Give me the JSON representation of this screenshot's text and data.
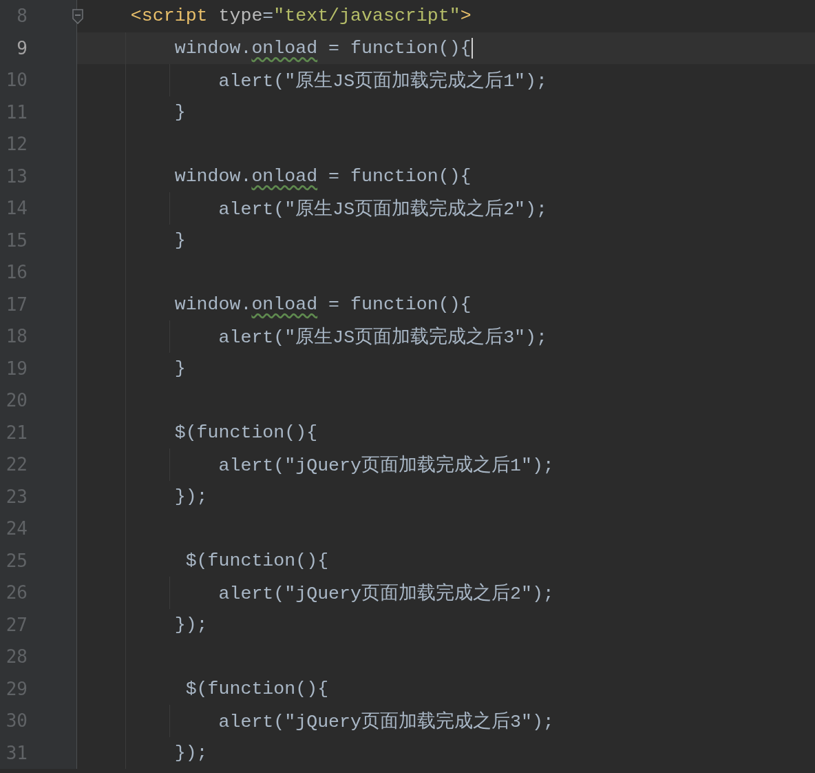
{
  "editor": {
    "lines": [
      {
        "number": "8",
        "selected": false,
        "foldable": true,
        "caret": false,
        "tokens": [
          {
            "kind": "tag",
            "text": "    <script"
          },
          {
            "kind": "attr",
            "text": " type"
          },
          {
            "kind": "plain",
            "text": "="
          },
          {
            "kind": "string",
            "text": "\"text/javascript\""
          },
          {
            "kind": "tag",
            "text": ">"
          }
        ]
      },
      {
        "number": "9",
        "selected": true,
        "foldable": false,
        "caret": true,
        "tokens": [
          {
            "kind": "plain",
            "text": "        window."
          },
          {
            "kind": "warn",
            "text": "onload"
          },
          {
            "kind": "plain",
            "text": " = function(){"
          }
        ]
      },
      {
        "number": "10",
        "selected": false,
        "foldable": false,
        "caret": false,
        "tokens": [
          {
            "kind": "plain",
            "text": "            alert(\"原生JS页面加载完成之后1\");"
          }
        ]
      },
      {
        "number": "11",
        "selected": false,
        "foldable": false,
        "caret": false,
        "tokens": [
          {
            "kind": "plain",
            "text": "        }"
          }
        ]
      },
      {
        "number": "12",
        "selected": false,
        "foldable": false,
        "caret": false
      },
      {
        "number": "13",
        "selected": false,
        "foldable": false,
        "caret": false,
        "tokens": [
          {
            "kind": "plain",
            "text": "        window."
          },
          {
            "kind": "warn",
            "text": "onload"
          },
          {
            "kind": "plain",
            "text": " = function(){"
          }
        ]
      },
      {
        "number": "14",
        "selected": false,
        "foldable": false,
        "caret": false,
        "tokens": [
          {
            "kind": "plain",
            "text": "            alert(\"原生JS页面加载完成之后2\");"
          }
        ]
      },
      {
        "number": "15",
        "selected": false,
        "foldable": false,
        "caret": false,
        "tokens": [
          {
            "kind": "plain",
            "text": "        }"
          }
        ]
      },
      {
        "number": "16",
        "selected": false,
        "foldable": false,
        "caret": false
      },
      {
        "number": "17",
        "selected": false,
        "foldable": false,
        "caret": false,
        "tokens": [
          {
            "kind": "plain",
            "text": "        window."
          },
          {
            "kind": "warn",
            "text": "onload"
          },
          {
            "kind": "plain",
            "text": " = function(){"
          }
        ]
      },
      {
        "number": "18",
        "selected": false,
        "foldable": false,
        "caret": false,
        "tokens": [
          {
            "kind": "plain",
            "text": "            alert(\"原生JS页面加载完成之后3\");"
          }
        ]
      },
      {
        "number": "19",
        "selected": false,
        "foldable": false,
        "caret": false,
        "tokens": [
          {
            "kind": "plain",
            "text": "        }"
          }
        ]
      },
      {
        "number": "20",
        "selected": false,
        "foldable": false,
        "caret": false
      },
      {
        "number": "21",
        "selected": false,
        "foldable": false,
        "caret": false,
        "tokens": [
          {
            "kind": "plain",
            "text": "        $(function(){"
          }
        ]
      },
      {
        "number": "22",
        "selected": false,
        "foldable": false,
        "caret": false,
        "tokens": [
          {
            "kind": "plain",
            "text": "            alert(\"jQuery页面加载完成之后1\");"
          }
        ]
      },
      {
        "number": "23",
        "selected": false,
        "foldable": false,
        "caret": false,
        "tokens": [
          {
            "kind": "plain",
            "text": "        });"
          }
        ]
      },
      {
        "number": "24",
        "selected": false,
        "foldable": false,
        "caret": false
      },
      {
        "number": "25",
        "selected": false,
        "foldable": false,
        "caret": false,
        "tokens": [
          {
            "kind": "plain",
            "text": "         $(function(){"
          }
        ]
      },
      {
        "number": "26",
        "selected": false,
        "foldable": false,
        "caret": false,
        "tokens": [
          {
            "kind": "plain",
            "text": "            alert(\"jQuery页面加载完成之后2\");"
          }
        ]
      },
      {
        "number": "27",
        "selected": false,
        "foldable": false,
        "caret": false,
        "tokens": [
          {
            "kind": "plain",
            "text": "        });"
          }
        ]
      },
      {
        "number": "28",
        "selected": false,
        "foldable": false,
        "caret": false
      },
      {
        "number": "29",
        "selected": false,
        "foldable": false,
        "caret": false,
        "tokens": [
          {
            "kind": "plain",
            "text": "         $(function(){"
          }
        ]
      },
      {
        "number": "30",
        "selected": false,
        "foldable": false,
        "caret": false,
        "tokens": [
          {
            "kind": "plain",
            "text": "            alert(\"jQuery页面加载完成之后3\");"
          }
        ]
      },
      {
        "number": "31",
        "selected": false,
        "foldable": false,
        "caret": false,
        "tokens": [
          {
            "kind": "plain",
            "text": "        });"
          }
        ]
      }
    ]
  }
}
